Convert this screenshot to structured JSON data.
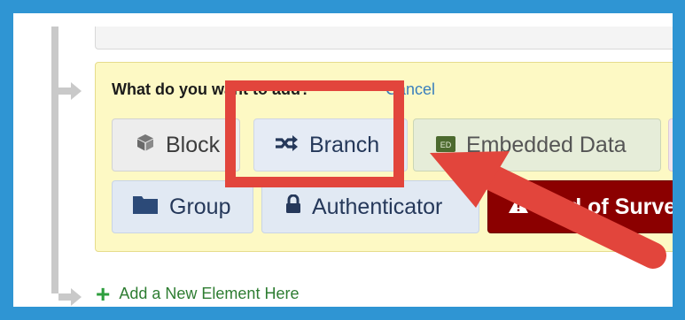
{
  "panel": {
    "prompt": "What do you want to add?",
    "cancel": "Cancel"
  },
  "buttons": {
    "block": "Block",
    "branch": "Branch",
    "embedded_data": "Embedded Data",
    "group": "Group",
    "authenticator": "Authenticator",
    "end_of_survey": "End of Survey"
  },
  "add_new": {
    "plus": "+",
    "label": "Add a New Element Here"
  },
  "colors": {
    "frame": "#2f95d3",
    "panel": "#fdf9c4",
    "highlight": "#e2453c",
    "end_of_survey": "#8b0000"
  }
}
